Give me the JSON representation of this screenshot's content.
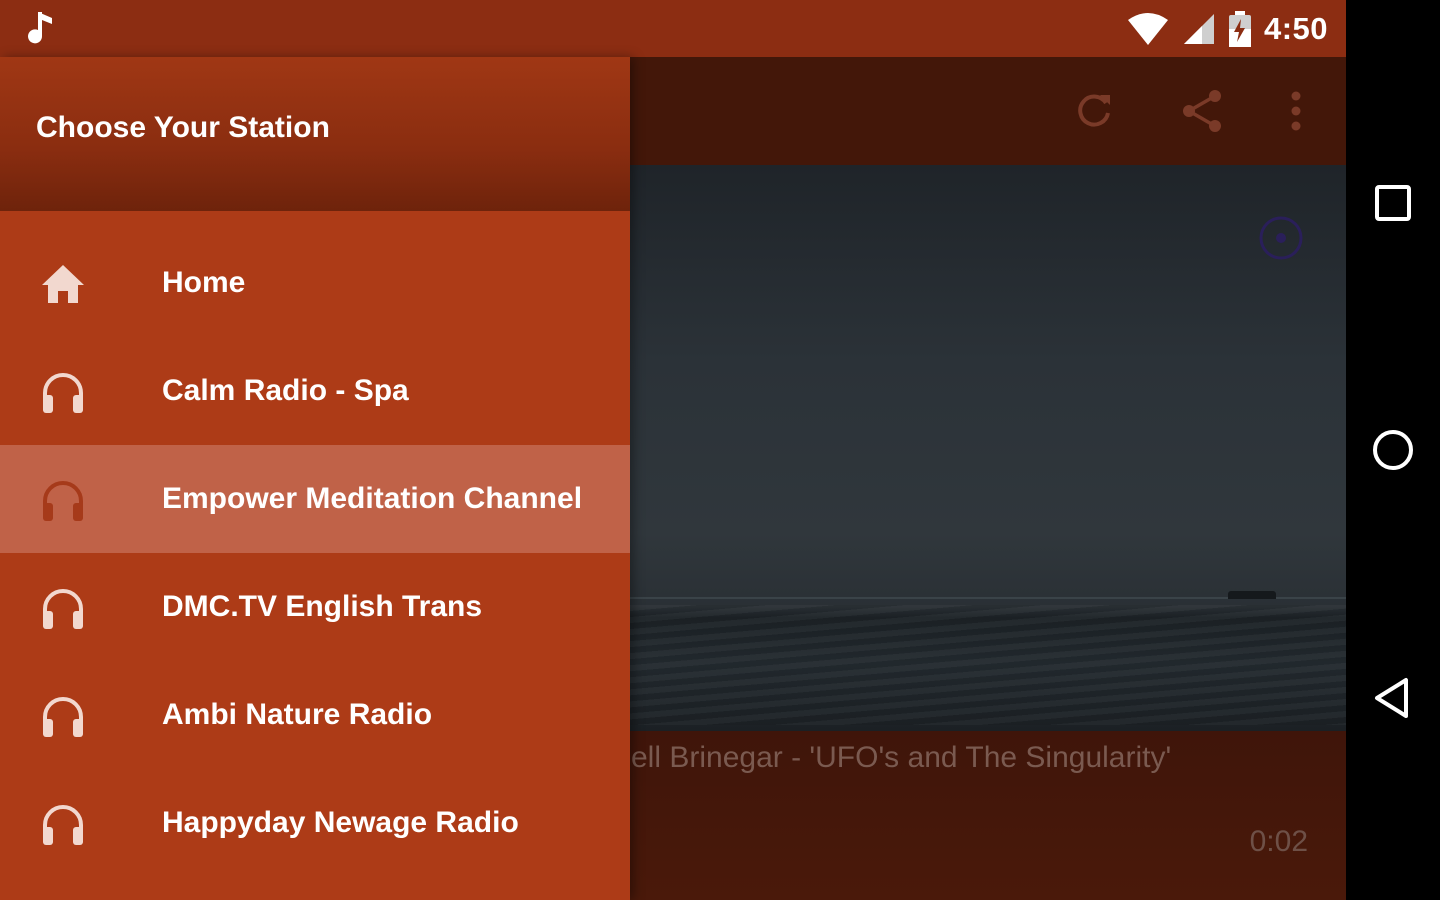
{
  "status_bar": {
    "time": "4:50",
    "icons": [
      "music-note-icon",
      "wifi-icon",
      "signal-icon",
      "battery-charging-icon"
    ]
  },
  "drawer": {
    "title": "Choose Your Station",
    "items": [
      {
        "label": "Home",
        "icon": "home-icon",
        "active": false
      },
      {
        "label": "Calm Radio - Spa",
        "icon": "headphones-icon",
        "active": false
      },
      {
        "label": "Empower Meditation Channel",
        "icon": "headphones-icon",
        "active": true
      },
      {
        "label": "DMC.TV English Trans",
        "icon": "headphones-icon",
        "active": false
      },
      {
        "label": "Ambi Nature Radio",
        "icon": "headphones-icon",
        "active": false
      },
      {
        "label": "Happyday Newage Radio",
        "icon": "headphones-icon",
        "active": false
      }
    ]
  },
  "toolbar": {
    "actions": [
      "refresh-icon",
      "share-icon",
      "more-vert-icon"
    ]
  },
  "player": {
    "track_title": "sell Brinegar - 'UFO's and The Singularity'",
    "elapsed": "0:02"
  },
  "nav_bar": {
    "buttons": [
      "recents-square-icon",
      "home-circle-icon",
      "back-triangle-icon"
    ]
  },
  "colors": {
    "status_bar": "#8c2d12",
    "drawer_bg": "#ad3b17",
    "drawer_active": "#c06248",
    "toolbar": "#431709"
  }
}
